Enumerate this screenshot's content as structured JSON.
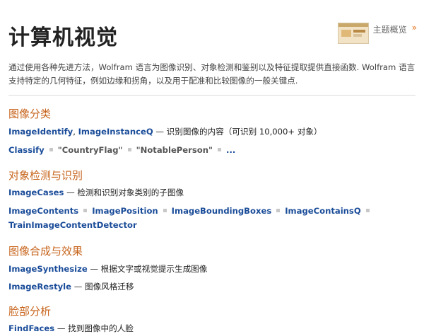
{
  "page": {
    "title": "计算机视觉",
    "overview_label": "主题概览",
    "overview_arrow": "»",
    "intro": "通过使用各种先进方法，Wolfram 语言为图像识别、对象检测和鉴别以及特征提取提供直接函数. Wolfram 语言支持特定的几何特征，例如边缘和拐角，以及用于配准和比较图像的一般关键点."
  },
  "sections": [
    {
      "title": "图像分类",
      "lines": [
        {
          "fn1": "ImageIdentify",
          "comma": ", ",
          "fn2": "ImageInstanceQ",
          "desc": " — 识别图像的内容（可识别 10,000+ 对象）"
        },
        {
          "items": [
            "Classify",
            "\"CountryFlag\"",
            "\"NotablePerson\"",
            "..."
          ]
        }
      ]
    },
    {
      "title": "对象检测与识别",
      "lines": [
        {
          "fn1": "ImageCases",
          "desc": " — 检测和识别对象类别的子图像"
        },
        {
          "items": [
            "ImageContents",
            "ImagePosition",
            "ImageBoundingBoxes",
            "ImageContainsQ"
          ],
          "wrap": "TrainImageContentDetector"
        }
      ]
    },
    {
      "title": "图像合成与效果",
      "lines": [
        {
          "fn1": "ImageSynthesize",
          "desc": " — 根据文字或视觉提示生成图像"
        },
        {
          "fn1": "ImageRestyle",
          "desc": " — 图像风格迁移"
        }
      ]
    },
    {
      "title": "脸部分析",
      "lines": [
        {
          "fn1": "FindFaces",
          "desc": " — 找到图像中的人脸"
        }
      ]
    }
  ]
}
